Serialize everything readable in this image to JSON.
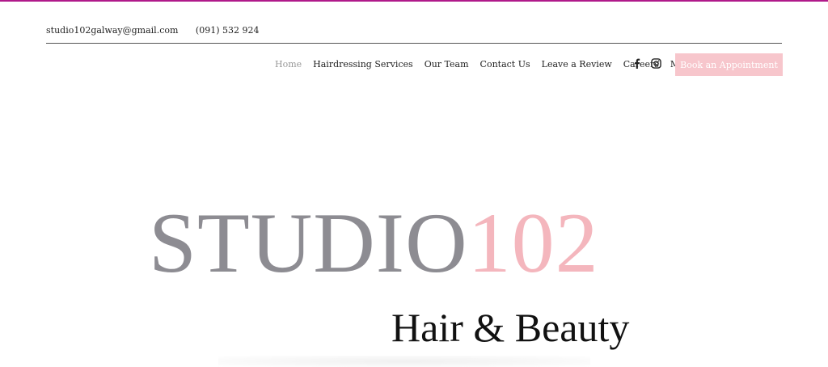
{
  "header": {
    "email": "studio102galway@gmail.com",
    "phone": "(091) 532 924"
  },
  "nav": {
    "items": [
      {
        "label": "Home"
      },
      {
        "label": "Hairdressing Services"
      },
      {
        "label": "Our Team"
      },
      {
        "label": "Contact Us"
      },
      {
        "label": "Leave a Review"
      },
      {
        "label": "Careers"
      },
      {
        "label": "More"
      }
    ]
  },
  "social": {
    "icons": [
      "facebook-icon",
      "instagram-icon"
    ]
  },
  "cta": {
    "label": "Book an Appointment"
  },
  "logo": {
    "word_grey": "STUDIO",
    "word_pink": "102",
    "tagline": "Hair & Beauty"
  },
  "colors": {
    "accent_line": "#b01a8a",
    "button_bg": "#f7c6cc",
    "logo_grey": "#8d8c92",
    "logo_pink": "#f4b6bd"
  }
}
